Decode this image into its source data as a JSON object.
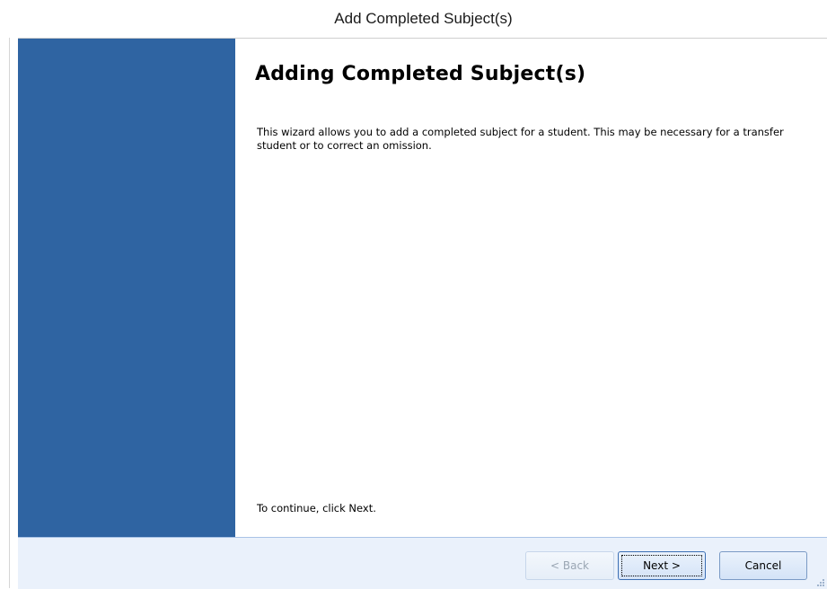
{
  "window": {
    "title": "Add Completed Subject(s)"
  },
  "wizard": {
    "heading": "Adding Completed Subject(s)",
    "intro": "This wizard allows you to add a completed subject for a student. This may be necessary for a transfer student or to correct an omission.",
    "continue_hint": "To continue, click Next."
  },
  "buttons": {
    "back": "< Back",
    "next": "Next >",
    "cancel": "Cancel",
    "back_enabled": false,
    "next_focused": true
  },
  "colors": {
    "side_panel": "#2f64a2",
    "footer": "#eaf1fb"
  },
  "icons": [
    "resize-grip-icon"
  ]
}
